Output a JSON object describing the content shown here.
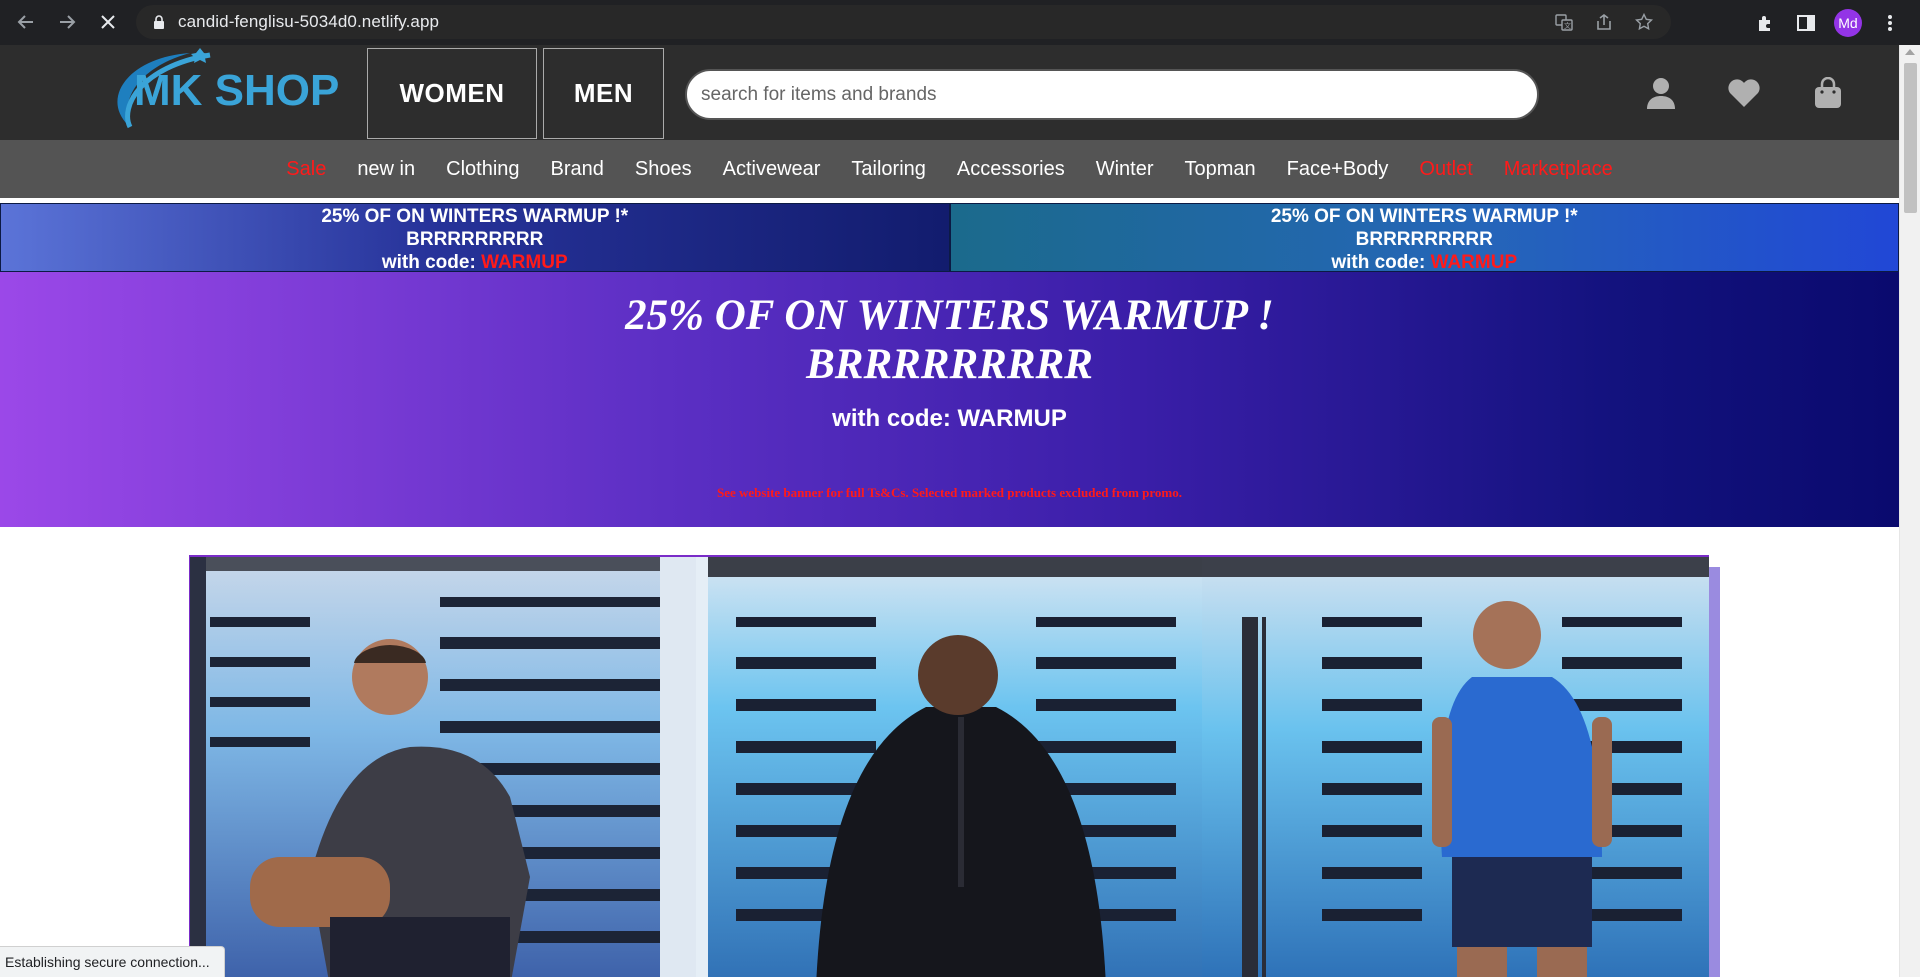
{
  "browser": {
    "url": "candid-fenglisu-5034d0.netlify.app",
    "profile_initials": "Md",
    "status_text": "Establishing secure connection..."
  },
  "header": {
    "logo_text": "MK SHOP",
    "women_label": "WOMEN",
    "men_label": "MEN",
    "search_placeholder": "search for items and brands"
  },
  "nav": {
    "items": [
      {
        "label": "Sale",
        "highlight": true
      },
      {
        "label": "new in",
        "highlight": false
      },
      {
        "label": "Clothing",
        "highlight": false
      },
      {
        "label": "Brand",
        "highlight": false
      },
      {
        "label": "Shoes",
        "highlight": false
      },
      {
        "label": "Activewear",
        "highlight": false
      },
      {
        "label": "Tailoring",
        "highlight": false
      },
      {
        "label": "Accessories",
        "highlight": false
      },
      {
        "label": "Winter",
        "highlight": false
      },
      {
        "label": "Topman",
        "highlight": false
      },
      {
        "label": "Face+Body",
        "highlight": false
      },
      {
        "label": "Outlet",
        "highlight": true
      },
      {
        "label": "Marketplace",
        "highlight": true
      }
    ]
  },
  "promo_bar": {
    "line1": "25% OF ON WINTERS WARMUP !*",
    "line2": "BRRRRRRRRR",
    "code_prefix": "with code: ",
    "code": "WARMUP"
  },
  "banner": {
    "title_line1": "25% OF ON WINTERS WARMUP !",
    "title_line2": "BRRRRRRRRR",
    "code_line": "with code: WARMUP",
    "terms": "See website banner for full Ts&Cs. Selected marked products excluded from promo."
  },
  "colors": {
    "header_bg": "#2d2d2d",
    "nav_bg": "#545454",
    "highlight_red": "#ff1a1a",
    "logo_blue": "#3aa4d8"
  }
}
